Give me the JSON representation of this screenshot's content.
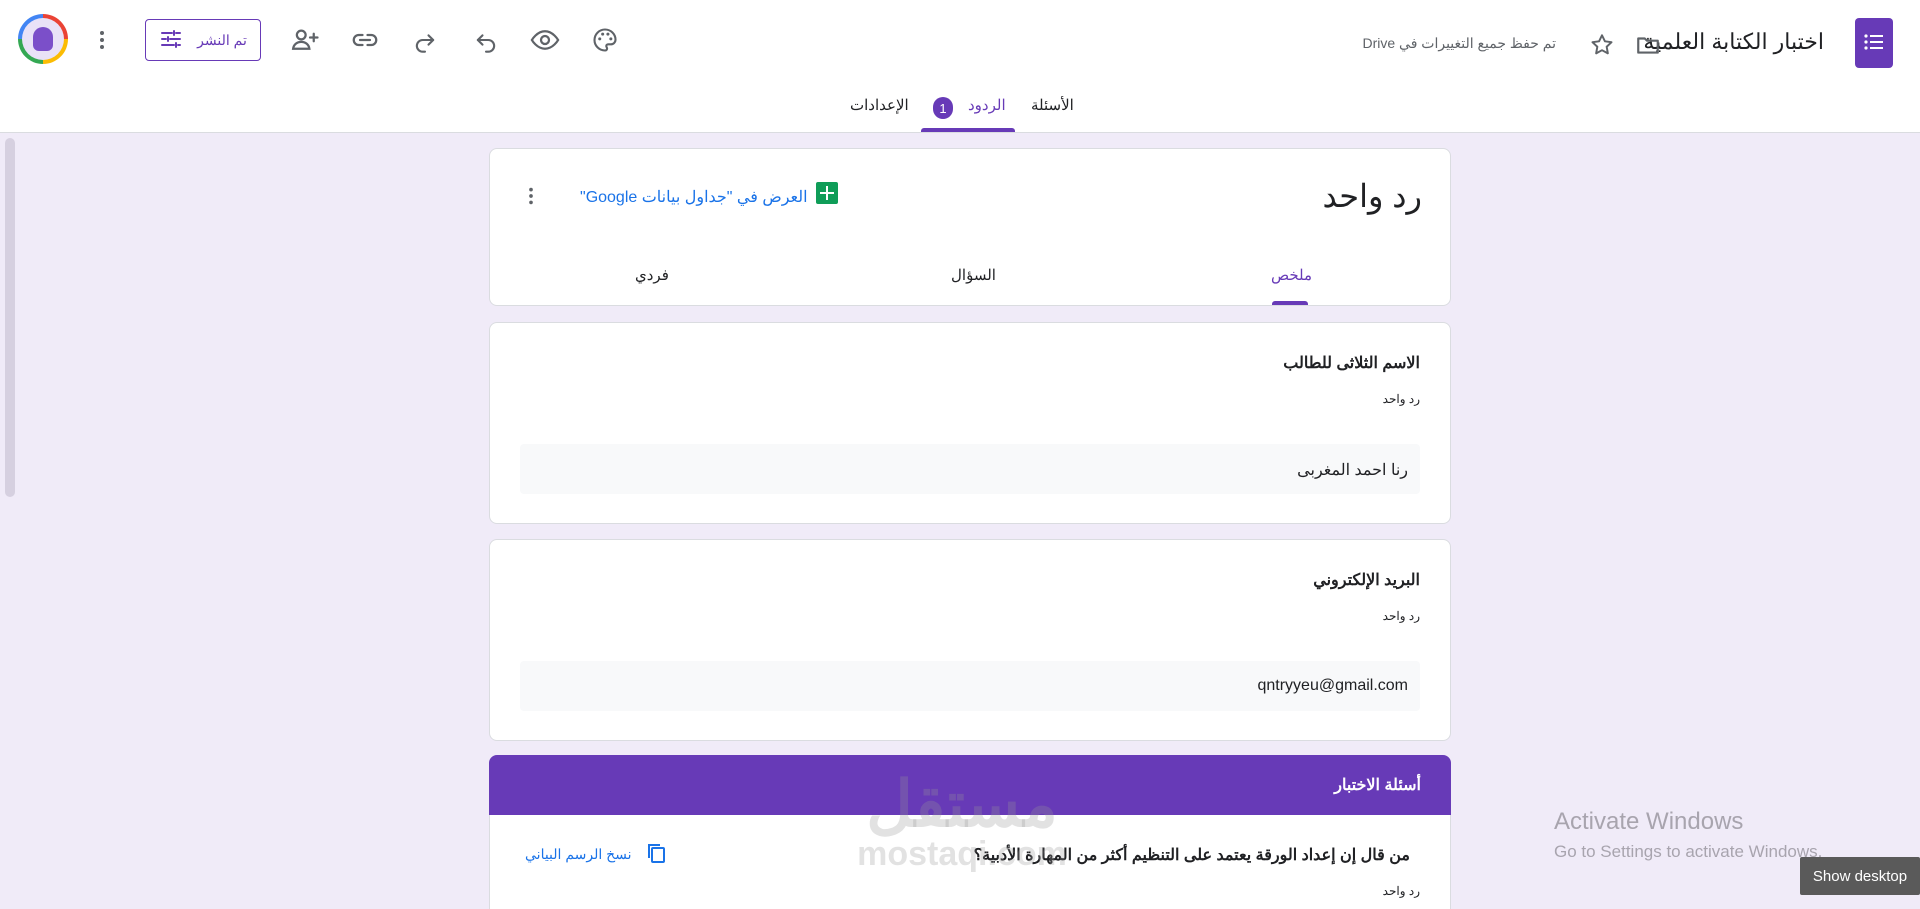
{
  "app": {
    "doc_title": "اختبار الكتابة العلمية",
    "saved_status": "تم حفظ جميع التغييرات في Drive",
    "publish_label": "تم النشر",
    "accent_color": "#673ab7"
  },
  "tabs": [
    {
      "label": "الأسئلة"
    },
    {
      "label": "الردود",
      "badge": "1",
      "active": true
    },
    {
      "label": "الإعدادات"
    }
  ],
  "summary": {
    "title": "رد واحد",
    "sheets_link": "العرض في \"جداول بيانات Google\"",
    "sub_tabs": [
      {
        "label": "ملخص",
        "active": true
      },
      {
        "label": "السؤال"
      },
      {
        "label": "فردي"
      }
    ]
  },
  "questions": [
    {
      "title": "الاسم الثلاثى للطالب",
      "count": "رد واحد",
      "answer": "رنا احمد المغربى"
    },
    {
      "title": "البريد الإلكتروني",
      "count": "رد واحد",
      "answer": "qntryyeu@gmail.com"
    }
  ],
  "quiz": {
    "header": "أسئلة الاختبار",
    "question": "من قال إن إعداد الورقة يعتمد على التنظيم أكثر من المهارة الأدبية؟",
    "count": "رد واحد",
    "copy_chart": "نسخ الرسم البياني"
  },
  "overlays": {
    "watermark_ar": "مستقل",
    "watermark_en": "mostaqi.com",
    "activate_title": "Activate Windows",
    "activate_sub": "Go to Settings to activate Windows.",
    "show_desktop": "Show desktop"
  },
  "icons": [
    "forms-logo-icon",
    "folder-icon",
    "star-icon",
    "palette-icon",
    "preview-icon",
    "undo-icon",
    "redo-icon",
    "link-icon",
    "add-collaborator-icon",
    "tune-icon",
    "more-vert-icon",
    "sheets-icon",
    "copy-icon"
  ]
}
